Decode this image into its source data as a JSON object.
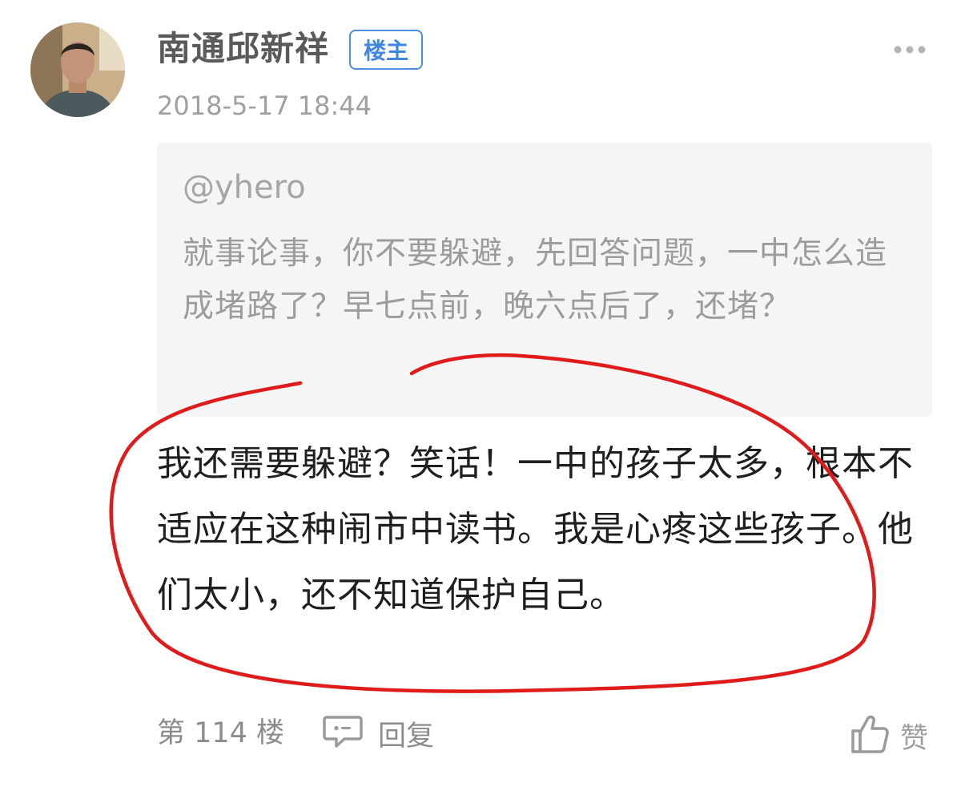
{
  "post": {
    "author": "南通邱新祥",
    "badge": "楼主",
    "timestamp": "2018-5-17 18:44",
    "quote": {
      "user": "@yhero",
      "text": "就事论事，你不要躲避，先回答问题，一中怎么造成堵路了？早七点前，晚六点后了，还堵？"
    },
    "content": "我还需要躲避？笑话！一中的孩子太多，根本不适应在这种闹市中读书。我是心疼这些孩子。他们太小，还不知道保护自己。",
    "floor": "第 114 楼",
    "reply_label": "回复",
    "like_label": "赞"
  },
  "icons": {
    "more": "more-dots-icon",
    "reply": "comment-bubble-icon",
    "like": "thumbs-up-icon"
  },
  "colors": {
    "badge_blue": "#3f87e0",
    "annotation_red": "#e01b1b",
    "quote_bg": "#f5f5f5"
  }
}
